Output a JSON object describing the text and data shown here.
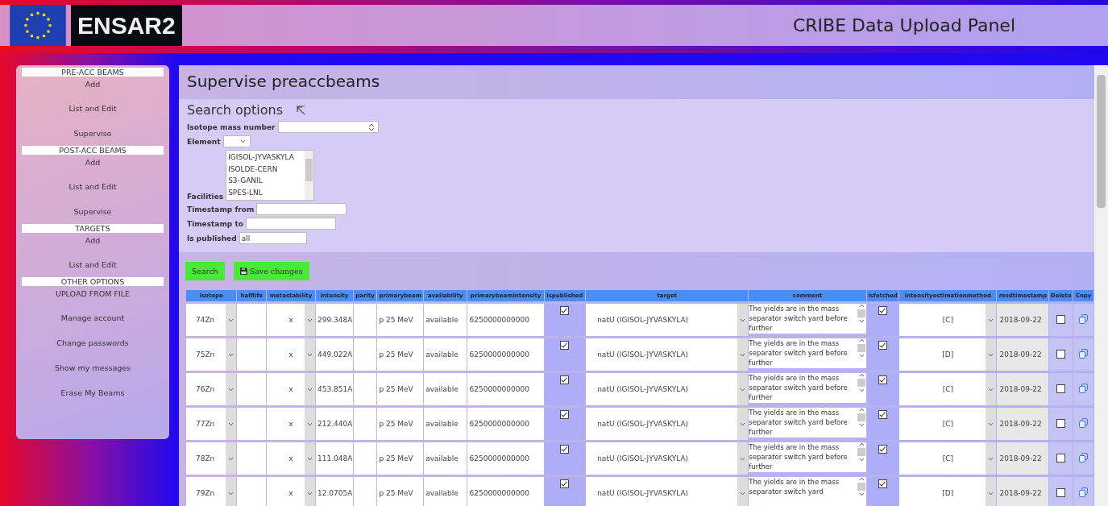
{
  "header": {
    "logo": "ENSAR2",
    "title": "CRIBE Data Upload Panel"
  },
  "sidebar": [
    {
      "heading": "PRE-ACC BEAMS",
      "items": [
        "Add",
        "List and Edit",
        "Supervise"
      ]
    },
    {
      "heading": "POST-ACC BEAMS",
      "items": [
        "Add",
        "List and Edit",
        "Supervise"
      ]
    },
    {
      "heading": "TARGETS",
      "items": [
        "Add",
        "List and Edit"
      ]
    },
    {
      "heading": "OTHER OPTIONS",
      "items": [
        "UPLOAD FROM FILE",
        "Manage account",
        "Change passwords",
        "Show my messages",
        "Erase My Beams"
      ]
    }
  ],
  "page_title": "Supervise preaccbeams",
  "search": {
    "title": "Search options",
    "mass_label": "Isotope mass number",
    "element_label": "Element",
    "facilities_label": "Facilities",
    "facilities": [
      {
        "label": "IGISOL-JYVASKYLA",
        "selected": false
      },
      {
        "label": "ISOLDE-CERN",
        "selected": false
      },
      {
        "label": "S3-GANIL",
        "selected": false
      },
      {
        "label": "SPES-LNL",
        "selected": false
      }
    ],
    "from_label": "Timestamp from",
    "to_label": "Timestamp to",
    "published_label": "Is published",
    "published_value": "all"
  },
  "buttons": {
    "search": "Search",
    "save": "Save changes"
  },
  "table": {
    "columns": [
      "isotope",
      "halflife",
      "metastability",
      "intensity",
      "parity",
      "primarybeam",
      "availability",
      "primarybeamintensity",
      "ispublished",
      "target",
      "comment",
      "isfetched",
      "intensityestimationmethod",
      "modtimestamp",
      "Delete",
      "Copy"
    ],
    "rows": [
      {
        "isotope": "74Zn",
        "metastability": "x",
        "intensity": "299.348A",
        "primarybeam": "p 25 MeV",
        "availability": "available",
        "primarybeamintensity": "6250000000000",
        "ispublished": true,
        "target": "natU (IGISOL-JYVASKYLA)",
        "comment": "The yields are in the mass separator switch yard before further",
        "isfetched": true,
        "method": "[C]",
        "timestamp": "2018-09-22",
        "delete": false
      },
      {
        "isotope": "75Zn",
        "metastability": "x",
        "intensity": "449.022A",
        "primarybeam": "p 25 MeV",
        "availability": "available",
        "primarybeamintensity": "6250000000000",
        "ispublished": true,
        "target": "natU (IGISOL-JYVASKYLA)",
        "comment": "The yields are in the mass separator switch yard before further",
        "isfetched": true,
        "method": "[D]",
        "timestamp": "2018-09-22",
        "delete": false
      },
      {
        "isotope": "76Zn",
        "metastability": "x",
        "intensity": "453.851A",
        "primarybeam": "p 25 MeV",
        "availability": "available",
        "primarybeamintensity": "6250000000000",
        "ispublished": true,
        "target": "natU (IGISOL-JYVASKYLA)",
        "comment": "The yields are in the mass separator switch yard before further",
        "isfetched": true,
        "method": "[C]",
        "timestamp": "2018-09-22",
        "delete": false
      },
      {
        "isotope": "77Zn",
        "metastability": "x",
        "intensity": "212.440A",
        "primarybeam": "p 25 MeV",
        "availability": "available",
        "primarybeamintensity": "6250000000000",
        "ispublished": true,
        "target": "natU (IGISOL-JYVASKYLA)",
        "comment": "The yields are in the mass separator switch yard before further",
        "isfetched": true,
        "method": "[C]",
        "timestamp": "2018-09-22",
        "delete": false
      },
      {
        "isotope": "78Zn",
        "metastability": "x",
        "intensity": "111.048A",
        "primarybeam": "p 25 MeV",
        "availability": "available",
        "primarybeamintensity": "6250000000000",
        "ispublished": true,
        "target": "natU (IGISOL-JYVASKYLA)",
        "comment": "The yields are in the mass separator switch yard before further",
        "isfetched": true,
        "method": "[C]",
        "timestamp": "2018-09-22",
        "delete": false
      },
      {
        "isotope": "79Zn",
        "metastability": "x",
        "intensity": "12.0705A",
        "primarybeam": "p 25 MeV",
        "availability": "available",
        "primarybeamintensity": "6250000000000",
        "ispublished": true,
        "target": "natU (IGISOL-JYVASKYLA)",
        "comment": "The yields are in the mass separator switch yard",
        "isfetched": true,
        "method": "[D]",
        "timestamp": "2018-09-22",
        "delete": false
      }
    ]
  }
}
